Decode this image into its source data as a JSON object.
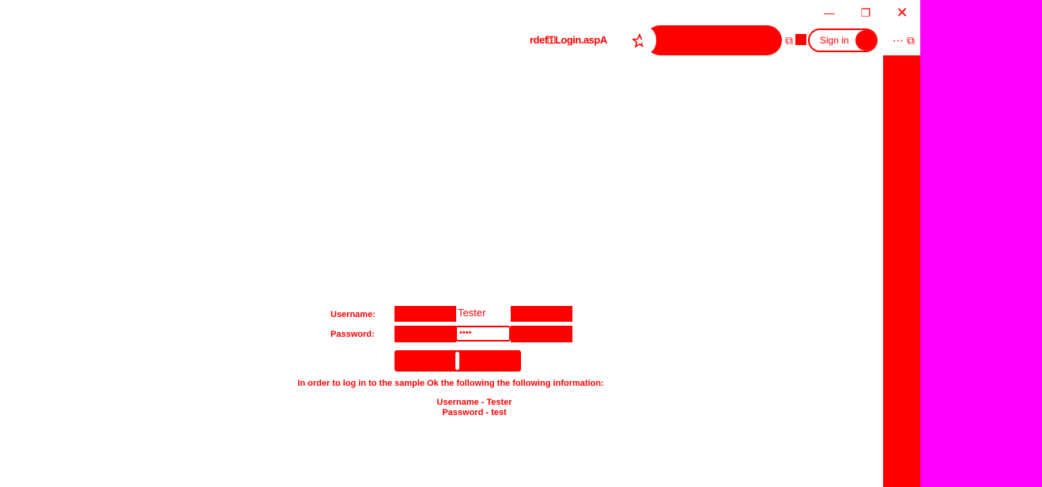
{
  "window": {
    "minimize_glyph": "—",
    "maximize_glyph": "❐",
    "close_glyph": "✕"
  },
  "toolbar": {
    "url_fragment": "rdef⚿Login.aspA",
    "favorite_icon": "star-icon",
    "signin_label": "Sign in",
    "more_glyph": "⋯",
    "tab_glyph": "⧉",
    "ext_glyph": "⧉"
  },
  "login_form": {
    "username_label": "Username:",
    "password_label": "Password:",
    "username_value": "Tester",
    "password_value": "••••"
  },
  "instructions": {
    "text": "In order to log in to the sample Ok the following the following information:",
    "username_line": "Username - Tester",
    "password_line": "Password - test"
  },
  "colors": {
    "accent": "#ff0000",
    "panel": "#ff00ff",
    "background": "#ffffff"
  }
}
